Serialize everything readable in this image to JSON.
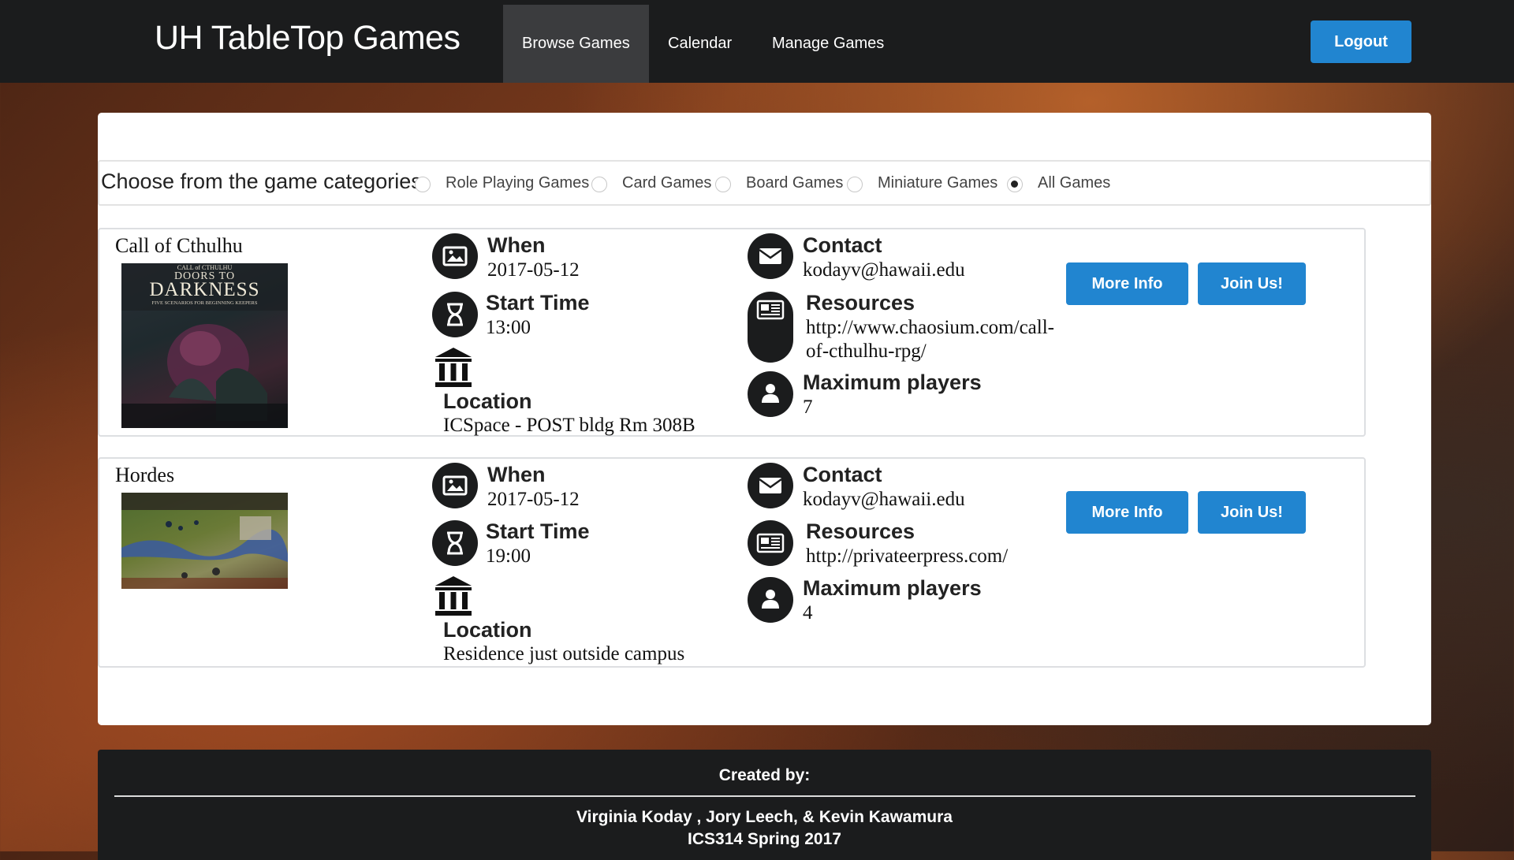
{
  "navbar": {
    "brand": "UH TableTop Games",
    "items": [
      {
        "label": "Browse Games",
        "active": true
      },
      {
        "label": "Calendar",
        "active": false
      },
      {
        "label": "Manage Games",
        "active": false
      }
    ],
    "logout_label": "Logout"
  },
  "filter": {
    "label": "Choose from the game categories",
    "options": [
      {
        "label": "Role Playing Games",
        "checked": false
      },
      {
        "label": "Card Games",
        "checked": false
      },
      {
        "label": "Board Games",
        "checked": false
      },
      {
        "label": "Miniature Games",
        "checked": false
      },
      {
        "label": "All Games",
        "checked": true
      }
    ]
  },
  "field_labels": {
    "when": "When",
    "start_time": "Start Time",
    "location": "Location",
    "contact": "Contact",
    "resources": "Resources",
    "max_players": "Maximum players"
  },
  "games": [
    {
      "title": "Call of Cthulhu",
      "when": "2017-05-12",
      "start_time": "13:00",
      "location": "ICSpace - POST bldg Rm 308B",
      "contact": "kodayv@hawaii.edu",
      "resources_line1": "http://www.chaosium.com/call-",
      "resources_line2": "of-cthulhu-rpg/",
      "max_players": "7",
      "cover": {
        "small_title": "CALL of CTHULHU",
        "line1": "DOORS TO",
        "line2": "DARKNESS",
        "subtitle": "FIVE SCENARIOS FOR BEGINNING KEEPERS"
      },
      "more_info_label": "More Info",
      "join_label": "Join Us!"
    },
    {
      "title": "Hordes",
      "when": "2017-05-12",
      "start_time": "19:00",
      "location": "Residence just outside campus",
      "contact": "kodayv@hawaii.edu",
      "resources_line1": "http://privateerpress.com/",
      "resources_line2": "",
      "max_players": "4",
      "more_info_label": "More Info",
      "join_label": "Join Us!"
    }
  ],
  "footer": {
    "title": "Created by:",
    "authors": "Virginia Koday , Jory Leech, & Kevin Kawamura",
    "course": "ICS314 Spring 2017"
  },
  "icons": [
    "image-icon",
    "hourglass-icon",
    "university-icon",
    "envelope-icon",
    "newspaper-icon",
    "user-icon"
  ],
  "colors": {
    "accent": "#2185d0",
    "nav_bg": "#1b1c1d",
    "nav_active": "#3b3c3e"
  }
}
